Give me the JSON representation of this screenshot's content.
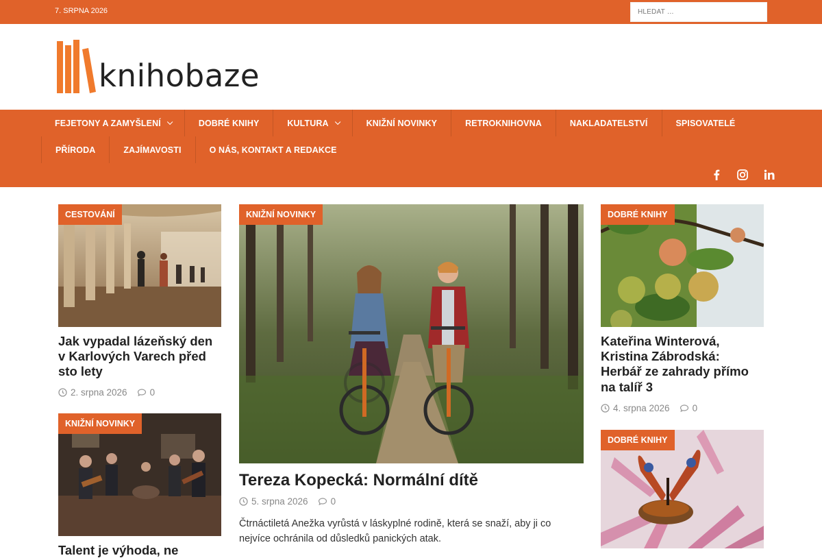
{
  "topbar": {
    "date": "7. SRPNA 2026",
    "search_placeholder": "HLEDAT …"
  },
  "logo": {
    "text": "knihobaze"
  },
  "nav": {
    "row1": [
      {
        "label": "FEJETONY A ZAMYŠLENÍ",
        "dropdown": true
      },
      {
        "label": "DOBRÉ KNIHY",
        "dropdown": false
      },
      {
        "label": "KULTURA",
        "dropdown": true
      },
      {
        "label": "KNIŽNÍ NOVINKY",
        "dropdown": false
      },
      {
        "label": "RETROKNIHOVNA",
        "dropdown": false
      },
      {
        "label": "NAKLADATELSTVÍ",
        "dropdown": false
      },
      {
        "label": "SPISOVATELÉ",
        "dropdown": false
      }
    ],
    "row2": [
      {
        "label": "PŘÍRODA"
      },
      {
        "label": "ZAJÍMAVOSTI"
      },
      {
        "label": "O NÁS, KONTAKT A REDAKCE"
      }
    ],
    "social": [
      "facebook-icon",
      "instagram-icon",
      "linkedin-icon"
    ]
  },
  "colors": {
    "accent": "#e0622a",
    "text": "#222222",
    "meta": "#888888"
  },
  "articles": {
    "left1": {
      "category": "CESTOVÁNÍ",
      "title": "Jak vypadal lázeňský den v Karlových Varech před sto lety",
      "date": "2. srpna 2026",
      "comments": "0"
    },
    "left2": {
      "category": "KNIŽNÍ NOVINKY",
      "title": "Talent je výhoda, ne",
      "date": "",
      "comments": ""
    },
    "main": {
      "category": "KNIŽNÍ NOVINKY",
      "title": "Tereza Kopecká: Normální dítě",
      "date": "5. srpna 2026",
      "comments": "0",
      "excerpt": "Čtrnáctiletá Anežka vyrůstá v láskyplné rodině, která se snaží, aby ji co nejvíce ochránila od důsledků panických atak."
    },
    "right1": {
      "category": "DOBRÉ KNIHY",
      "title": "Kateřina Winterová, Kristina Zábrodská: Herbář ze zahrady přímo na talíř 3",
      "date": "4. srpna 2026",
      "comments": "0"
    },
    "right2": {
      "category": "DOBRÉ KNIHY"
    }
  }
}
